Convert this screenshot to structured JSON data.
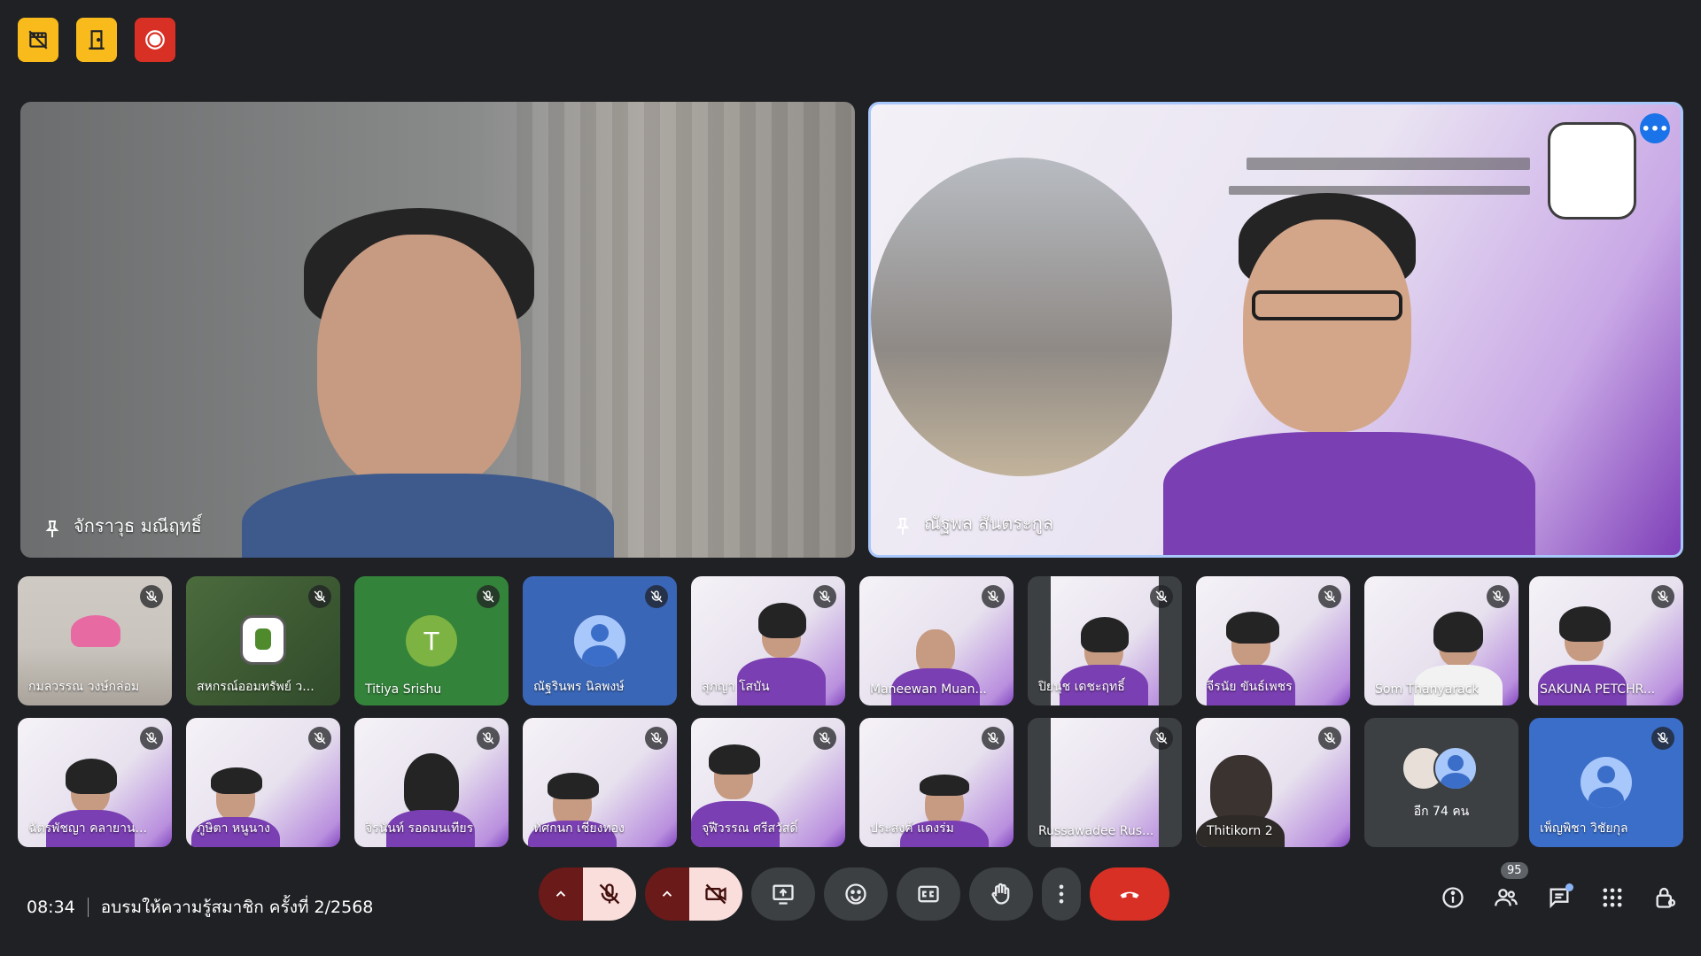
{
  "top_icons": [
    {
      "name": "no-video-icon",
      "color": "#f9bb1b"
    },
    {
      "name": "door-exit-icon",
      "color": "#f9bb1b"
    },
    {
      "name": "record-icon",
      "color": "#d93025"
    }
  ],
  "main_tiles": [
    {
      "name": "จักราวุธ มณีฤทธิ์",
      "pinned": true
    },
    {
      "name": "ณัฐพล สันตระกูล",
      "pinned": true,
      "active_speaker": true
    }
  ],
  "participants_row1": [
    {
      "name": "กมลวรรณ วงษ์กล่อม",
      "muted": true
    },
    {
      "name": "สหกรณ์ออมทรัพย์ ว...",
      "muted": true
    },
    {
      "name": "Titiya Srishu",
      "muted": true,
      "avatar_letter": "T"
    },
    {
      "name": "ณัฐรินพร นิลพงษ์",
      "muted": true
    },
    {
      "name": "สุภญา โสบัน",
      "muted": true
    },
    {
      "name": "Maneewan Muan...",
      "muted": true
    },
    {
      "name": "ปิยนุช เดชะฤทธิ์",
      "muted": true
    },
    {
      "name": "จีรนัย ขันธ์เพชร",
      "muted": true
    },
    {
      "name": "Som Thanyarack",
      "muted": true
    },
    {
      "name": "SAKUNA PETCHR...",
      "muted": true
    }
  ],
  "participants_row2": [
    {
      "name": "ฉัตรพัชญา คลายาน...",
      "muted": true
    },
    {
      "name": "ภูษิตา หนูนาง",
      "muted": true
    },
    {
      "name": "จิรนันท์ รอดมนเทียร",
      "muted": true
    },
    {
      "name": "ทัศกนก เชียงทอง",
      "muted": true
    },
    {
      "name": "จุฬีวรรณ ศรีสวัสดิ์",
      "muted": true
    },
    {
      "name": "ประสงค์ แดงร่ม",
      "muted": true
    },
    {
      "name": "Russawadee Rus...",
      "muted": true
    },
    {
      "name": "Thitikorn 2",
      "muted": true
    },
    {
      "name": "อีก 74 คน",
      "more": true
    },
    {
      "name": "เพ็ญพิชา วิชัยกุล",
      "muted": true
    }
  ],
  "bottom": {
    "time": "08:34",
    "meeting_title": "อบรมให้ความรู้สมาชิก ครั้งที่ 2/2568",
    "participant_count": "95"
  }
}
